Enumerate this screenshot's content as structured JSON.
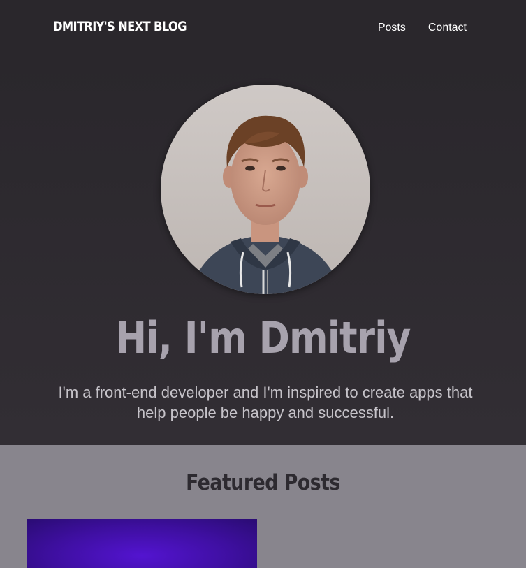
{
  "header": {
    "brand": "DMITRIY'S NEXT BLOG",
    "nav": [
      {
        "label": "Posts"
      },
      {
        "label": "Contact"
      }
    ]
  },
  "hero": {
    "avatar_icon": "profile-photo",
    "title": "Hi, I'm Dmitriy",
    "text": "I'm a front-end developer and I'm inspired to create apps that help people be happy and successful."
  },
  "featured": {
    "title": "Featured Posts"
  },
  "colors": {
    "header_bg": "#2a272c",
    "hero_title": "#a7a2ad",
    "featured_bg": "#88858d",
    "post_card": "#4a12b8"
  }
}
